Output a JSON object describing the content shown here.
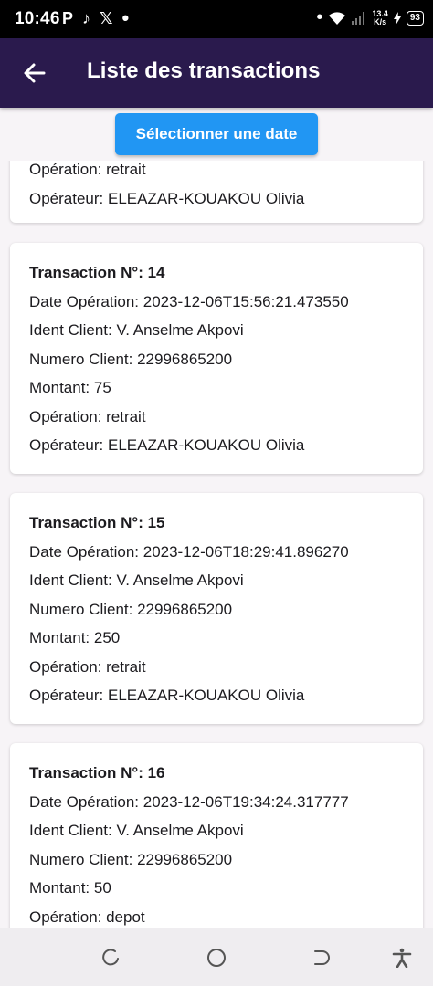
{
  "status_bar": {
    "time": "10:46",
    "notification_icons": [
      "P",
      "♪",
      "𝕏",
      "•"
    ],
    "dot": "•",
    "speed_value": "13.4",
    "speed_unit": "K/s",
    "battery": "93"
  },
  "app_bar": {
    "title": "Liste des transactions"
  },
  "date_button": {
    "label": "Sélectionner une date"
  },
  "transactions": [
    {
      "header": "",
      "date": "",
      "client": "",
      "numero": "",
      "montant": "",
      "operation": "Opération: retrait",
      "operateur": "Opérateur:  ELEAZAR-KOUAKOU Olivia"
    },
    {
      "header": "Transaction N°: 14",
      "date": "Date Opération: 2023-12-06T15:56:21.473550",
      "client": "Ident Client: V. Anselme Akpovi",
      "numero": "Numero Client: 22996865200",
      "montant": "Montant: 75",
      "operation": "Opération: retrait",
      "operateur": "Opérateur:  ELEAZAR-KOUAKOU Olivia"
    },
    {
      "header": "Transaction N°: 15",
      "date": "Date Opération: 2023-12-06T18:29:41.896270",
      "client": "Ident Client: V. Anselme Akpovi",
      "numero": "Numero Client: 22996865200",
      "montant": "Montant: 250",
      "operation": "Opération: retrait",
      "operateur": "Opérateur:  ELEAZAR-KOUAKOU Olivia"
    },
    {
      "header": "Transaction N°: 16",
      "date": "Date Opération: 2023-12-06T19:34:24.317777",
      "client": "Ident Client: V. Anselme Akpovi",
      "numero": "Numero Client: 22996865200",
      "montant": "Montant: 50",
      "operation": "Opération: depot",
      "operateur": ""
    }
  ],
  "nav_bar": {
    "icons": [
      "recent-apps-icon",
      "home-icon",
      "back-icon",
      "accessibility-icon"
    ]
  },
  "colors": {
    "app_bar": "#2a1a4d",
    "button": "#2196f3",
    "background": "#f7f4f7"
  }
}
